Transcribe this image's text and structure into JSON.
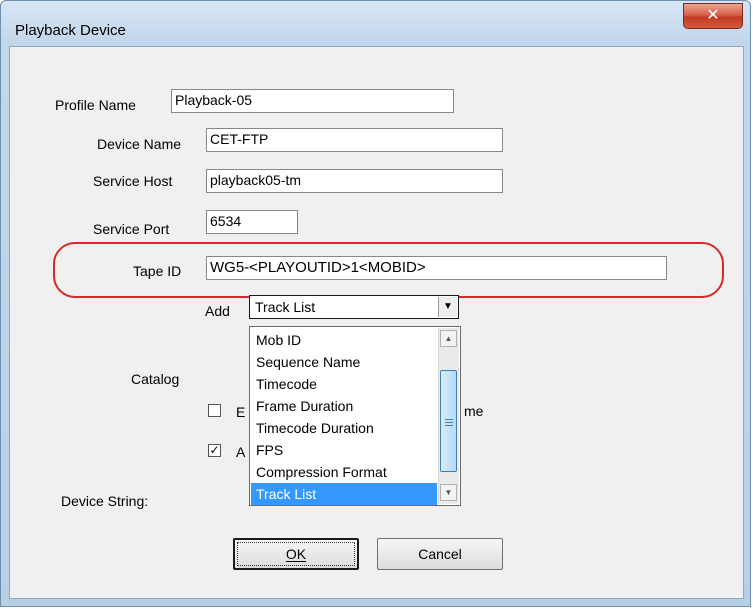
{
  "window": {
    "title": "Playback Device",
    "close_glyph": "✕"
  },
  "form": {
    "profile_name_label": "Profile Name",
    "profile_name_value": "Playback-05",
    "device_name_label": "Device Name",
    "device_name_value": "CET-FTP",
    "service_host_label": "Service Host",
    "service_host_value": "playback05-tm",
    "service_port_label": "Service Port",
    "service_port_value": "6534",
    "tape_id_label": "Tape ID",
    "tape_id_value": "WG5-<PLAYOUTID>1<MOBID>",
    "add_label": "Add",
    "add_selected": "Track List",
    "catalog_label": "Catalog",
    "checkbox1_partial_left": "E",
    "checkbox1_partial_right": "me",
    "checkbox1_checked": false,
    "checkbox2_partial": "A",
    "checkbox2_checked": true,
    "device_string_label": "Device String:"
  },
  "dropdown": {
    "items": [
      "Mob ID",
      "Sequence Name",
      "Timecode",
      "Frame Duration",
      "Timecode Duration",
      "FPS",
      "Compression Format",
      "Track List"
    ],
    "selected_index": 7
  },
  "buttons": {
    "ok": "OK",
    "cancel": "Cancel"
  },
  "colors": {
    "highlight": "#d62a2a",
    "selection": "#3399ff"
  }
}
